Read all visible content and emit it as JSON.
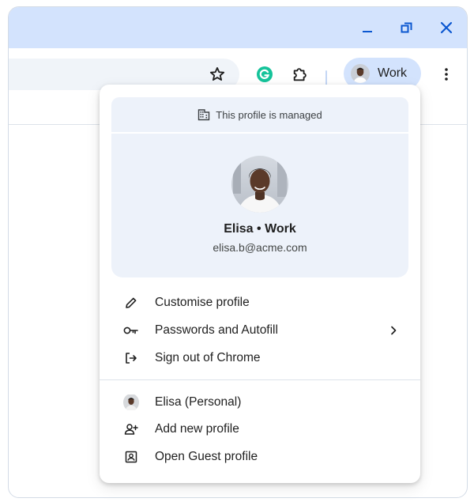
{
  "window": {
    "controls": {
      "minimize_icon": "minimize-icon",
      "restore_icon": "restore-icon",
      "close_icon": "close-icon"
    },
    "colors": {
      "titlebar": "#d3e3fd",
      "accent": "#0b57d0",
      "chip": "#d3e3fd"
    }
  },
  "toolbar": {
    "bookmark_icon": "star-icon",
    "grammarly_icon": "grammarly-icon",
    "extensions_icon": "puzzle-icon",
    "profile_chip_label": "Work",
    "menu_icon": "more-vert-icon"
  },
  "profile_menu": {
    "managed_notice": "This profile is managed",
    "name": "Elisa • Work",
    "email": "elisa.b@acme.com",
    "items": [
      {
        "label": "Customise profile",
        "icon": "pencil-icon"
      },
      {
        "label": "Passwords and Autofill",
        "icon": "key-icon",
        "has_submenu": true
      },
      {
        "label": "Sign out of Chrome",
        "icon": "sign-out-icon"
      }
    ],
    "other_profiles": [
      {
        "label": "Elisa (Personal)",
        "icon": "avatar"
      },
      {
        "label": "Add new profile",
        "icon": "person-add-icon"
      },
      {
        "label": "Open Guest profile",
        "icon": "guest-icon"
      }
    ]
  }
}
